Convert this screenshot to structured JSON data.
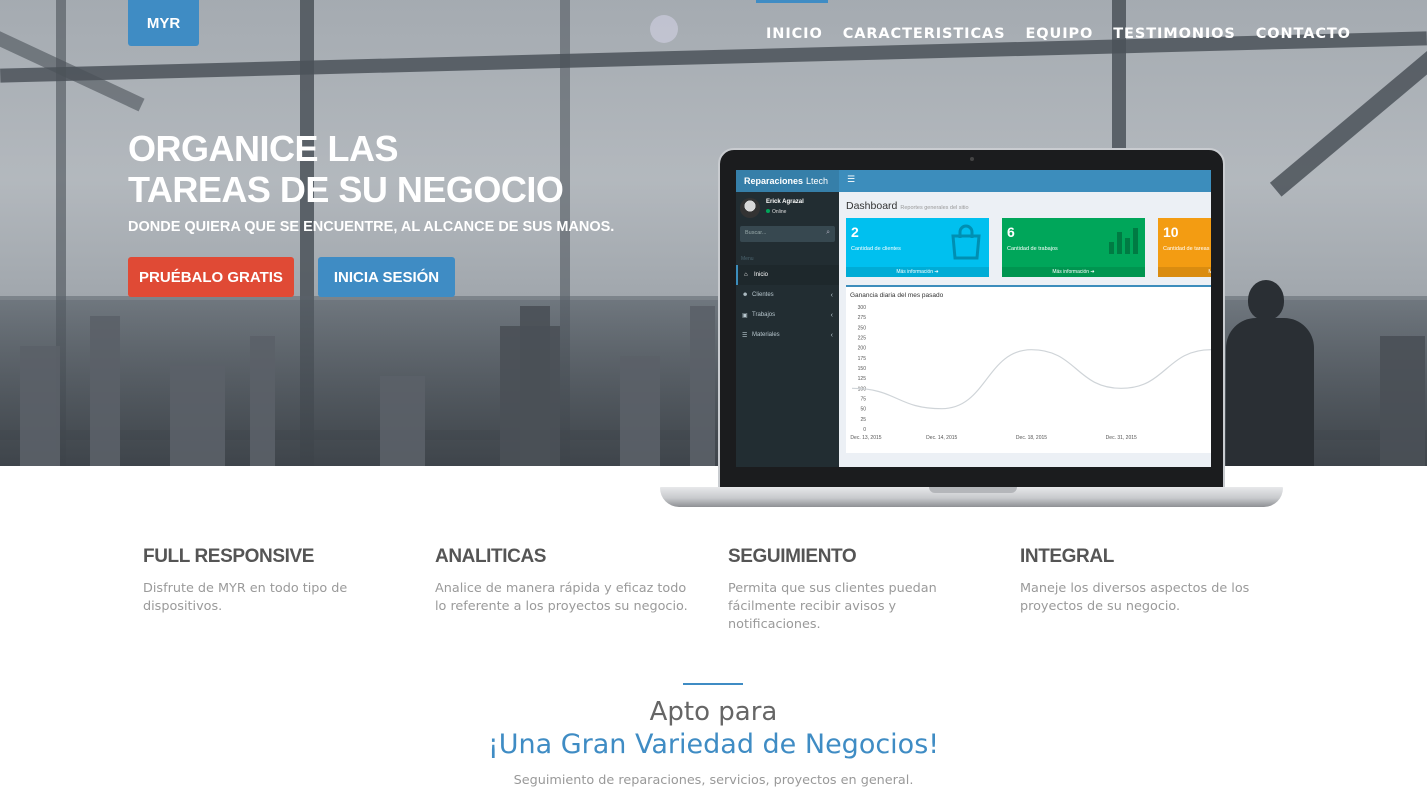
{
  "brand": {
    "logo": "MYR"
  },
  "nav": {
    "items": [
      "INICIO",
      "CARACTERISTICAS",
      "EQUIPO",
      "TESTIMONIOS",
      "CONTACTO"
    ]
  },
  "hero": {
    "title_line1": "ORGANICE LAS",
    "title_line2": "TAREAS DE SU NEGOCIO",
    "subtitle": "DONDE QUIERA QUE SE ENCUENTRE, AL ALCANCE DE SUS MANOS.",
    "cta_primary": "PRUÉBALO GRATIS",
    "cta_secondary": "INICIA SESIÓN",
    "colors": {
      "primary": "#e04a35",
      "secondary": "#3f8cc4"
    }
  },
  "dashboard": {
    "brand_bold": "Reparaciones",
    "brand_light": "Ltech",
    "user_name": "Erick Agrazal",
    "user_status": "Online",
    "search_placeholder": "Buscar...",
    "menu_header": "Menu",
    "menu": [
      {
        "label": "Inicio",
        "icon": "home-icon",
        "glyph": "⌂"
      },
      {
        "label": "Clientes",
        "icon": "users-icon",
        "glyph": "☻"
      },
      {
        "label": "Trabajos",
        "icon": "briefcase-icon",
        "glyph": "▣"
      },
      {
        "label": "Materiales",
        "icon": "list-icon",
        "glyph": "☰"
      }
    ],
    "page_title": "Dashboard",
    "page_subtitle": "Reportes generales del sitio",
    "boxes": [
      {
        "number": "2",
        "label": "Cantidad de clientes",
        "footer": "Más información ➔",
        "color": "#00c0ef"
      },
      {
        "number": "6",
        "label": "Cantidad de trabajos",
        "footer": "Más información ➔",
        "color": "#00a65a"
      },
      {
        "number": "10",
        "label": "Cantidad de tareas",
        "footer": "Más información ➔",
        "color": "#f39c12"
      }
    ],
    "chart_title": "Ganancia diaria del mes pasado"
  },
  "chart_data": {
    "type": "line",
    "title": "Ganancia diaria del mes pasado",
    "x": [
      "Dec. 13, 2015",
      "Dec. 14, 2015",
      "Dec. 18, 2015",
      "Dec. 31, 2015",
      ""
    ],
    "values": [
      100,
      50,
      195,
      100,
      195
    ],
    "ylim": [
      0,
      300
    ],
    "yticks": [
      0,
      25,
      50,
      75,
      100,
      125,
      150,
      175,
      200,
      225,
      250,
      275,
      300
    ],
    "xlabels": [
      "Dec. 13, 2015",
      "Dec. 14, 2015",
      "Dec. 18, 2015",
      "Dec. 31, 2015"
    ]
  },
  "features": [
    {
      "title": "FULL RESPONSIVE",
      "text": "Disfrute de MYR en todo tipo de dispositivos."
    },
    {
      "title": "ANALITICAS",
      "text": "Analice de manera rápida y eficaz todo lo referente a los proyectos su negocio."
    },
    {
      "title": "SEGUIMIENTO",
      "text": "Permita que sus clientes puedan fácilmente recibir avisos y notificaciones."
    },
    {
      "title": "INTEGRAL",
      "text": "Maneje los diversos aspectos de los proyectos de su negocio."
    }
  ],
  "section": {
    "kicker": "Apto para",
    "headline": "¡Una Gran Variedad de Negocios!",
    "tagline": "Seguimiento de reparaciones, servicios, proyectos en general."
  }
}
